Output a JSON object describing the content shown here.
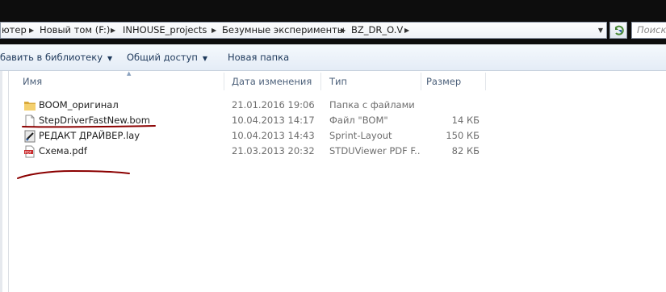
{
  "address": {
    "crumbs": [
      "ютер",
      "Новый том (F:)",
      "INHOUSE_projects",
      "Безумные эксперименты",
      "BZ_DR_O.V"
    ],
    "search_placeholder": "Поиск"
  },
  "toolbar": {
    "add_to_library": "бавить в библиотеку",
    "share": "Общий доступ",
    "new_folder": "Новая папка"
  },
  "columns": {
    "name": "Имя",
    "date": "Дата изменения",
    "type": "Тип",
    "size": "Размер"
  },
  "files": [
    {
      "name": "BOOM_оригинал",
      "date": "21.01.2016 19:06",
      "type": "Папка с файлами",
      "size": "",
      "icon": "folder-icon"
    },
    {
      "name": "StepDriverFastNew.bom",
      "date": "10.04.2013 14:17",
      "type": "Файл \"BOM\"",
      "size": "14 КБ",
      "icon": "document-icon"
    },
    {
      "name": "РЕДАКТ ДРАЙВЕР.lay",
      "date": "10.04.2013 14:43",
      "type": "Sprint-Layout",
      "size": "150 КБ",
      "icon": "sprint-layout-icon"
    },
    {
      "name": "Схема.pdf",
      "date": "21.03.2013 20:32",
      "type": "STDUViewer PDF F...",
      "size": "82 КБ",
      "icon": "pdf-icon"
    }
  ],
  "colors": {
    "annotation": "#8b0000",
    "toolbar_text": "#1e395b",
    "header_text": "#4c607a"
  }
}
